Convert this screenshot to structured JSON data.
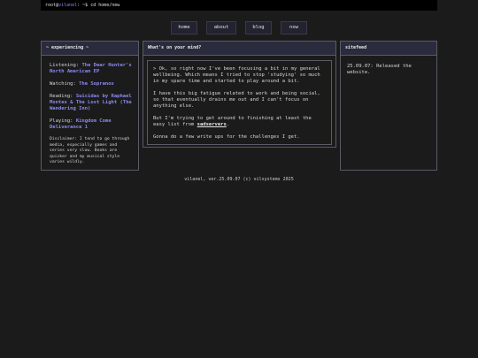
{
  "terminal": {
    "user": "root",
    "at": "@",
    "host": "vilanel",
    "command": ": ~$ cd home/new"
  },
  "nav": {
    "items": [
      {
        "label": "home"
      },
      {
        "label": "about"
      },
      {
        "label": "blog"
      },
      {
        "label": "now"
      }
    ]
  },
  "experiencing": {
    "title": "~ experiencing ~",
    "listening_label": "Listening:",
    "listening_value": "The Dear Hunter's North American EP",
    "watching_label": "Watching:",
    "watching_value": "The Sopranos",
    "reading_label": "Reading:",
    "reading_value": "Suicidas by Raphael Montes & The Lost Light (The Wandering Inn)",
    "playing_label": "Playing:",
    "playing_value": "Kingdom Come Deliverance 1",
    "disclaimer": "Disclaimer: I tend to go through media, especially games and series very slow. Books are quicker and my musical style varies wildly."
  },
  "mind": {
    "title": "What's on your mind?",
    "p1": "> Ok, so right now I've been focusing a bit in my general wellbeing. Which means I tried to stop 'studying' so much in my spare time and started to play around a bit.",
    "p2": "I have this big fatigue related to work and being social, so that eventually drains me out and I can't focus on anything else.",
    "p3_before": "But I'm trying to get around to finishing at least the easy list from ",
    "p3_link": "sadservers",
    "p3_after": ".",
    "p4": "Gonna do a few write ups for the challenges I get."
  },
  "sitefeed": {
    "title": "sitefeed",
    "entry": "25.09.07: Released the website."
  },
  "footer": {
    "text": "vilanel, ver.25.09.07 (c) vilsystems 2025"
  },
  "colors": {
    "accent": "#8a8af0",
    "background": "#1b1b1b",
    "panel_header": "#2a2b3c"
  }
}
